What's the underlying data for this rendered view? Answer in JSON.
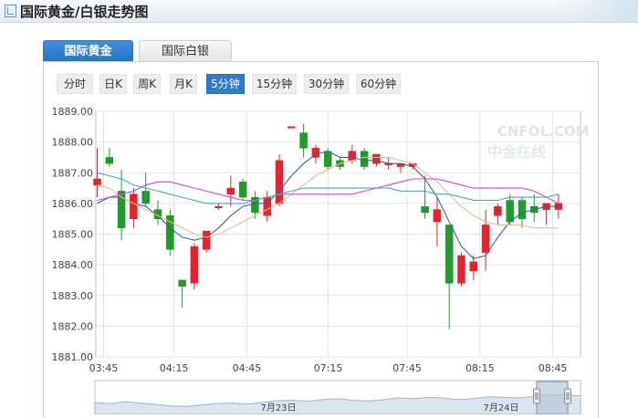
{
  "header": {
    "title": "国际黄金/白银走势图"
  },
  "tabs": [
    {
      "label": "国际黄金",
      "active": true
    },
    {
      "label": "国际白银",
      "active": false
    }
  ],
  "periods": [
    {
      "label": "分时",
      "selected": false
    },
    {
      "label": "日K",
      "selected": false
    },
    {
      "label": "周K",
      "selected": false
    },
    {
      "label": "月K",
      "selected": false
    },
    {
      "label": "5分钟",
      "selected": true
    },
    {
      "label": "15分钟",
      "selected": false
    },
    {
      "label": "30分钟",
      "selected": false
    },
    {
      "label": "60分钟",
      "selected": false
    }
  ],
  "watermark": {
    "latin": "CNFOL.COM",
    "chinese": "中金在线"
  },
  "navigator": {
    "dates": [
      "7月23日",
      "7月24日"
    ]
  },
  "colors": {
    "up": "#e8212a",
    "down": "#1f9a2b",
    "ma1": "#3b5fa8",
    "ma2": "#f5b883",
    "ma3": "#e63de0",
    "ma4": "#36b3b3",
    "grid": "#dfe3e8",
    "active_tab": "#2671c4"
  },
  "chart_data": {
    "type": "candlestick",
    "title": "",
    "xlabel": "",
    "ylabel": "",
    "ylim": [
      1881.0,
      1889.0
    ],
    "yticks": [
      "1889.00",
      "1888.00",
      "1887.00",
      "1886.00",
      "1885.00",
      "1884.00",
      "1883.00",
      "1882.00",
      "1881.00"
    ],
    "xticks": [
      "03:45",
      "04:15",
      "04:45",
      "07:15",
      "07:45",
      "08:15",
      "08:45"
    ],
    "grid": true,
    "candles": [
      {
        "o": 1886.6,
        "h": 1887.8,
        "l": 1886.2,
        "c": 1886.8
      },
      {
        "o": 1887.5,
        "h": 1887.8,
        "l": 1887.2,
        "c": 1887.3
      },
      {
        "o": 1886.4,
        "h": 1887.1,
        "l": 1884.8,
        "c": 1885.2
      },
      {
        "o": 1885.5,
        "h": 1886.5,
        "l": 1885.2,
        "c": 1886.3
      },
      {
        "o": 1886.4,
        "h": 1887.0,
        "l": 1885.9,
        "c": 1886.0
      },
      {
        "o": 1885.8,
        "h": 1886.1,
        "l": 1885.3,
        "c": 1885.5
      },
      {
        "o": 1885.6,
        "h": 1885.8,
        "l": 1884.3,
        "c": 1884.5
      },
      {
        "o": 1883.5,
        "h": 1883.5,
        "l": 1882.6,
        "c": 1883.3
      },
      {
        "o": 1883.4,
        "h": 1884.7,
        "l": 1883.2,
        "c": 1884.6
      },
      {
        "o": 1884.5,
        "h": 1885.1,
        "l": 1884.4,
        "c": 1885.1
      },
      {
        "o": 1885.9,
        "h": 1886.0,
        "l": 1885.8,
        "c": 1885.9
      },
      {
        "o": 1886.3,
        "h": 1886.9,
        "l": 1885.9,
        "c": 1886.5
      },
      {
        "o": 1886.7,
        "h": 1886.8,
        "l": 1886.1,
        "c": 1886.2
      },
      {
        "o": 1886.2,
        "h": 1886.4,
        "l": 1885.5,
        "c": 1885.7
      },
      {
        "o": 1885.6,
        "h": 1886.4,
        "l": 1885.4,
        "c": 1886.2
      },
      {
        "o": 1886.0,
        "h": 1887.6,
        "l": 1885.9,
        "c": 1887.4
      },
      {
        "o": 1888.5,
        "h": 1888.5,
        "l": 1888.5,
        "c": 1888.5
      },
      {
        "o": 1888.3,
        "h": 1888.6,
        "l": 1887.5,
        "c": 1887.8
      },
      {
        "o": 1887.5,
        "h": 1887.9,
        "l": 1887.3,
        "c": 1887.8
      },
      {
        "o": 1887.7,
        "h": 1887.8,
        "l": 1887.1,
        "c": 1887.2
      },
      {
        "o": 1887.4,
        "h": 1887.5,
        "l": 1887.1,
        "c": 1887.2
      },
      {
        "o": 1887.4,
        "h": 1887.9,
        "l": 1887.3,
        "c": 1887.7
      },
      {
        "o": 1887.7,
        "h": 1887.8,
        "l": 1887.1,
        "c": 1887.2
      },
      {
        "o": 1887.3,
        "h": 1887.6,
        "l": 1887.2,
        "c": 1887.6
      },
      {
        "o": 1887.3,
        "h": 1887.5,
        "l": 1887.1,
        "c": 1887.3
      },
      {
        "o": 1887.2,
        "h": 1887.3,
        "l": 1887.0,
        "c": 1887.3
      },
      {
        "o": 1887.2,
        "h": 1887.3,
        "l": 1887.1,
        "c": 1887.3
      },
      {
        "o": 1885.9,
        "h": 1886.9,
        "l": 1885.5,
        "c": 1885.7
      },
      {
        "o": 1885.4,
        "h": 1886.2,
        "l": 1884.6,
        "c": 1885.8
      },
      {
        "o": 1885.3,
        "h": 1885.3,
        "l": 1881.9,
        "c": 1883.4
      },
      {
        "o": 1883.4,
        "h": 1884.4,
        "l": 1883.3,
        "c": 1884.3
      },
      {
        "o": 1883.8,
        "h": 1884.3,
        "l": 1883.5,
        "c": 1884.1
      },
      {
        "o": 1884.4,
        "h": 1885.8,
        "l": 1883.8,
        "c": 1885.3
      },
      {
        "o": 1885.6,
        "h": 1886.0,
        "l": 1885.3,
        "c": 1885.9
      },
      {
        "o": 1886.1,
        "h": 1886.3,
        "l": 1885.3,
        "c": 1885.4
      },
      {
        "o": 1886.1,
        "h": 1886.2,
        "l": 1885.2,
        "c": 1885.5
      },
      {
        "o": 1885.9,
        "h": 1886.3,
        "l": 1885.4,
        "c": 1885.7
      },
      {
        "o": 1885.8,
        "h": 1886.0,
        "l": 1885.3,
        "c": 1886.0
      },
      {
        "o": 1885.8,
        "h": 1886.3,
        "l": 1885.5,
        "c": 1886.0
      }
    ],
    "moving_averages": [
      {
        "values": [
          1886.0,
          1886.2,
          1886.2,
          1886.0,
          1885.9,
          1885.6,
          1885.2,
          1884.9,
          1884.8,
          1884.9,
          1885.2,
          1885.6,
          1885.9,
          1886.0,
          1886.0,
          1886.4,
          1886.9,
          1887.3,
          1887.6,
          1887.7,
          1887.5,
          1887.5,
          1887.4,
          1887.4,
          1887.3,
          1887.3,
          1887.2,
          1886.8,
          1886.2,
          1885.4,
          1884.6,
          1884.2,
          1884.3,
          1884.9,
          1885.4,
          1885.7,
          1885.8,
          1885.9,
          1885.9
        ]
      },
      {
        "values": [
          1886.6,
          1886.5,
          1886.2,
          1886.0,
          1885.8,
          1885.6,
          1885.4,
          1885.2,
          1885.0,
          1884.9,
          1885.0,
          1885.2,
          1885.4,
          1885.6,
          1885.8,
          1886.0,
          1886.3,
          1886.6,
          1886.9,
          1887.1,
          1887.3,
          1887.4,
          1887.5,
          1887.5,
          1887.5,
          1887.4,
          1887.3,
          1887.0,
          1886.7,
          1886.3,
          1885.9,
          1885.6,
          1885.4,
          1885.3,
          1885.3,
          1885.3,
          1885.2,
          1885.2,
          1885.2
        ]
      },
      {
        "values": [
          1886.1,
          1886.2,
          1886.3,
          1886.4,
          1886.6,
          1886.7,
          1886.7,
          1886.6,
          1886.5,
          1886.4,
          1886.3,
          1886.2,
          1886.1,
          1886.1,
          1886.2,
          1886.3,
          1886.3,
          1886.3,
          1886.3,
          1886.3,
          1886.3,
          1886.3,
          1886.4,
          1886.5,
          1886.6,
          1886.7,
          1886.8,
          1886.8,
          1886.8,
          1886.7,
          1886.6,
          1886.5,
          1886.5,
          1886.5,
          1886.5,
          1886.5,
          1886.4,
          1886.2,
          1886.0
        ]
      },
      {
        "values": [
          1887.0,
          1886.9,
          1886.8,
          1886.6,
          1886.5,
          1886.4,
          1886.3,
          1886.2,
          1886.1,
          1886.0,
          1886.0,
          1886.0,
          1886.0,
          1886.1,
          1886.2,
          1886.3,
          1886.4,
          1886.5,
          1886.5,
          1886.5,
          1886.5,
          1886.5,
          1886.5,
          1886.5,
          1886.5,
          1886.4,
          1886.4,
          1886.4,
          1886.3,
          1886.3,
          1886.2,
          1886.1,
          1886.1,
          1886.1,
          1886.2,
          1886.2,
          1886.2,
          1886.2,
          1886.3
        ]
      }
    ],
    "navigator_series": [
      0.42,
      0.38,
      0.45,
      0.4,
      0.35,
      0.3,
      0.28,
      0.33,
      0.38,
      0.4,
      0.36,
      0.42,
      0.48,
      0.5,
      0.46,
      0.52,
      0.55,
      0.5,
      0.47,
      0.52,
      0.58,
      0.55,
      0.6,
      0.57,
      0.52,
      0.56,
      0.62,
      0.6,
      0.58,
      0.64,
      0.7,
      0.68,
      0.66
    ]
  }
}
